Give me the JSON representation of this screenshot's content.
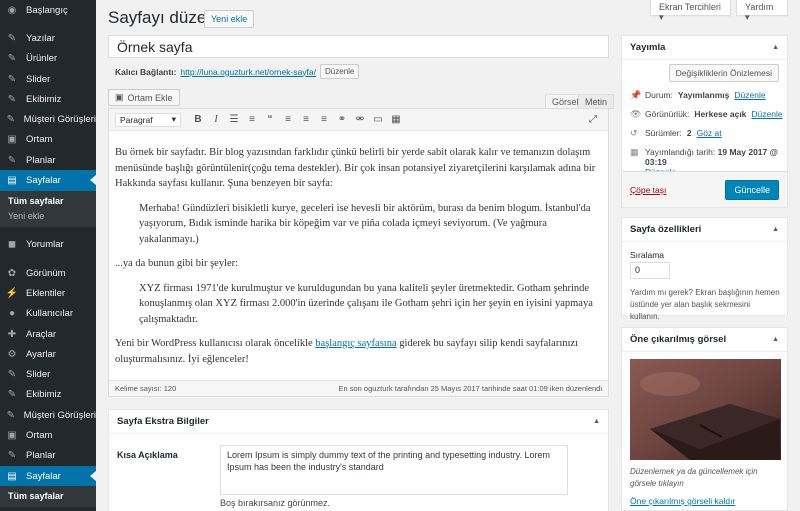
{
  "sidebar": {
    "items": [
      {
        "label": "Başlangıç",
        "icon": "dashboard-icon"
      },
      {
        "label": "Yazılar",
        "icon": "pin-icon"
      },
      {
        "label": "Ürünler",
        "icon": "pin-icon"
      },
      {
        "label": "Slider",
        "icon": "pin-icon"
      },
      {
        "label": "Ekibimiz",
        "icon": "pin-icon"
      },
      {
        "label": "Müşteri Görüşleri",
        "icon": "pin-icon"
      },
      {
        "label": "Ortam",
        "icon": "media-icon"
      },
      {
        "label": "Planlar",
        "icon": "pin-icon"
      },
      {
        "label": "Sayfalar",
        "icon": "pages-icon"
      },
      {
        "label": "Yorumlar",
        "icon": "comments-icon"
      },
      {
        "label": "Görünüm",
        "icon": "appearance-icon"
      },
      {
        "label": "Eklentiler",
        "icon": "plugins-icon"
      },
      {
        "label": "Kullanıcılar",
        "icon": "users-icon"
      },
      {
        "label": "Araçlar",
        "icon": "tools-icon"
      },
      {
        "label": "Ayarlar",
        "icon": "settings-icon"
      },
      {
        "label": "Slider",
        "icon": "pin-icon"
      },
      {
        "label": "Ekibimiz",
        "icon": "pin-icon"
      },
      {
        "label": "Müşteri Görüşleri",
        "icon": "pin-icon"
      },
      {
        "label": "Ortam",
        "icon": "media-icon"
      },
      {
        "label": "Planlar",
        "icon": "pin-icon"
      },
      {
        "label": "Sayfalar",
        "icon": "pages-icon"
      }
    ],
    "submenu": [
      "Tüm sayfalar",
      "Yeni ekle"
    ],
    "bottom_submenu": "Tüm sayfalar",
    "active_color": "#0073aa"
  },
  "header": {
    "title": "Sayfayı düzenle",
    "add_new": "Yeni ekle",
    "screen_options": "Ekran Tercihleri",
    "help": "Yardım"
  },
  "post": {
    "title": "Örnek sayfa",
    "permalink_label": "Kalıcı Bağlantı:",
    "permalink_url": "http://luna.oguzturk.net/ornek-sayfa/",
    "permalink_edit": "Düzenle"
  },
  "editor": {
    "add_media": "Ortam Ekle",
    "tab_visual": "Görsel",
    "tab_text": "Metin",
    "format": "Paragraf",
    "p1": "Bu örnek bir sayfadır. Bir blog yazısından farklıdır çünkü belirli bir yerde sabit olarak kalır ve temanızın dolaşım menüsünde başlığı görüntülenir(çoğu tema destekler). Bir çok insan potansiyel ziyaretçilerini karşılamak adına bir Hakkında sayfası kullanır. Şuna benzeyen bir sayfa:",
    "q1": "Merhaba! Gündüzleri bisikletli kurye, geceleri ise hevesli bir aktörüm, burası da benim blogum. İstanbul'da yaşıyorum, Bıdık isminde harika bir köpeğim var ve piña colada içmeyi seviyorum. (Ve yağmura yakalanmayı.)",
    "p2": "...ya da bunun gibi bir şeyler:",
    "q2": "XYZ firması 1971'de kurulmuştur ve kuruldugundan bu yana kaliteli şeyler üretmektedir. Gotham şehrinde konuşlanmış olan XYZ firması 2.000'in üzerinde çalışanı ile Gotham şehri için her şeyin en iyisini yapmaya çalışmaktadır.",
    "p3_before": "Yeni bir WordPress kullanıcısı olarak öncelikle ",
    "p3_link": "başlangıç sayfasına",
    "p3_after": " giderek bu sayfayı silip kendi sayfalarınızı oluşturmalısınız. İyi eğlenceler!",
    "word_count": "Kelime sayısı: 120",
    "last_edited": "En son oguzturk tarafından 25 Mayıs 2017 tarihinde saat 01:09 iken düzenlendi"
  },
  "extra": {
    "title": "Sayfa Ekstra Bilgiler",
    "short_desc_label": "Kısa Açıklama",
    "short_desc": "Lorem Ipsum is simply dummy text of the printing and typesetting industry. Lorem Ipsum has been the industry's standard",
    "hint": "Boş bırakırsanız görünmez."
  },
  "publish": {
    "title": "Yayımla",
    "preview": "Değişikliklerin Önizlemesi",
    "status_label": "Durum:",
    "status_value": "Yayımlanmış",
    "visibility_label": "Görünürlük:",
    "visibility_value": "Herkese açık",
    "revisions_label": "Sürümler:",
    "revisions_count": "2",
    "revisions_link": "Göz at",
    "date_label": "Yayımlandığı tarih:",
    "date_value": "19 May 2017 @ 03:19",
    "edit": "Düzenle",
    "trash": "Çöpe taşı",
    "update": "Güncelle"
  },
  "attributes": {
    "title": "Sayfa özellikleri",
    "order_label": "Sıralama",
    "order_value": "0",
    "help": "Yardım mı gerek? Ekran başlığının hemen üstünde yer alan başlık sekmesini kullanın."
  },
  "featured": {
    "title": "Öne çıkarılmış görsel",
    "caption": "Düzenlemek ya da güncellemek için görsele tıklayın",
    "remove": "Öne çıkarılmış görseli kaldır"
  }
}
